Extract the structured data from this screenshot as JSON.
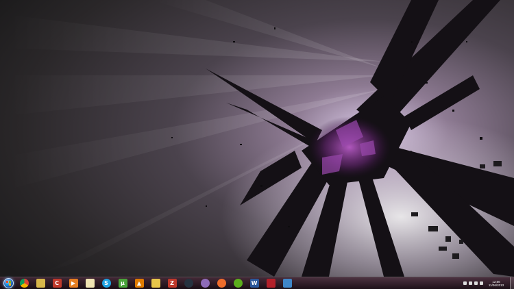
{
  "colors": {
    "taskbar": "#3a1f2e",
    "accent_purple": "#8e3fa0"
  },
  "taskbar": {
    "start": "start-button",
    "pinned": [
      {
        "name": "chrome",
        "icon": "chrome-icon",
        "glyph": "",
        "bg": "#2f8b3a"
      },
      {
        "name": "explorer",
        "icon": "folder-icon",
        "glyph": "",
        "bg": "#d8b64a"
      },
      {
        "name": "ccleaner",
        "icon": "ccleaner-icon",
        "glyph": "C",
        "bg": "#c0392b"
      },
      {
        "name": "media-player",
        "icon": "media-player-icon",
        "glyph": "▶",
        "bg": "#e67e22"
      },
      {
        "name": "notepad",
        "icon": "notepad-icon",
        "glyph": "",
        "bg": "#f1e4b3"
      },
      {
        "name": "skype",
        "icon": "skype-icon",
        "glyph": "S",
        "bg": "#1ea1e0"
      },
      {
        "name": "utorrent",
        "icon": "utorrent-icon",
        "glyph": "µ",
        "bg": "#4aa33b"
      },
      {
        "name": "vlc",
        "icon": "vlc-icon",
        "glyph": "▲",
        "bg": "#e07b00"
      },
      {
        "name": "puzzle",
        "icon": "puzzle-icon",
        "glyph": "",
        "bg": "#e8c64a"
      },
      {
        "name": "filezilla",
        "icon": "filezilla-icon",
        "glyph": "Z",
        "bg": "#c0392b"
      },
      {
        "name": "steam",
        "icon": "steam-icon",
        "glyph": "",
        "bg": "#26323f"
      },
      {
        "name": "app-purple",
        "icon": "purple-app-icon",
        "glyph": "",
        "bg": "#8e6bb8"
      },
      {
        "name": "origin",
        "icon": "origin-icon",
        "glyph": "",
        "bg": "#ef6c2b"
      },
      {
        "name": "spotify",
        "icon": "spotify-icon",
        "glyph": "",
        "bg": "#5cae1c"
      },
      {
        "name": "word",
        "icon": "word-icon",
        "glyph": "W",
        "bg": "#2b579a"
      },
      {
        "name": "app-red",
        "icon": "red-app-icon",
        "glyph": "",
        "bg": "#b3202a"
      },
      {
        "name": "app-blue",
        "icon": "blue-app-icon",
        "glyph": "",
        "bg": "#3f86c8"
      }
    ],
    "clock": {
      "time": "12:56",
      "date": "11/06/2013"
    }
  }
}
